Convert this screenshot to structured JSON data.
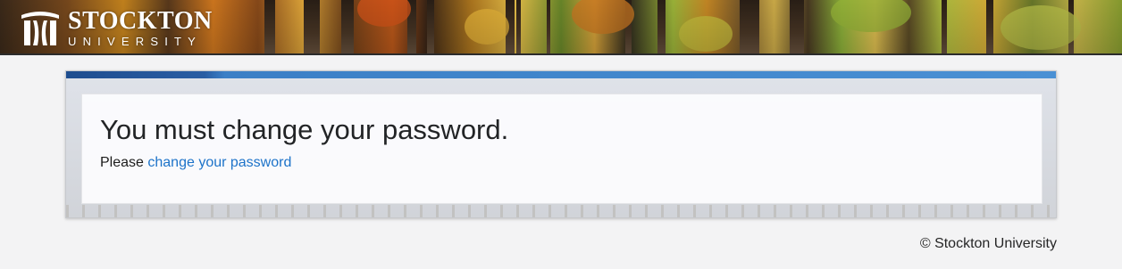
{
  "header": {
    "logo": {
      "name": "STOCKTON",
      "sub": "UNIVERSITY"
    },
    "banner_icon": "autumn-forest-photo"
  },
  "main": {
    "title": "You must change your password.",
    "prompt_prefix": "Please",
    "link_label": "change your password"
  },
  "footer": {
    "copyright": "© Stockton University"
  },
  "colors": {
    "accent_bar": "#1e4d8f",
    "accent_bar_light": "#4a90d4",
    "link": "#1d73c9",
    "page_bg": "#f3f3f4"
  }
}
